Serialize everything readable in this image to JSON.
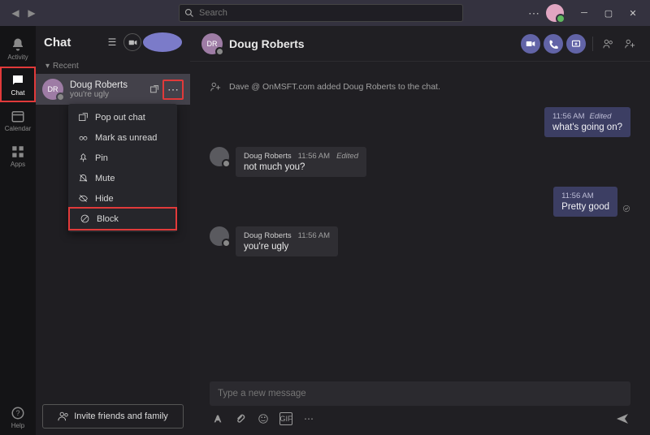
{
  "titlebar": {
    "search_placeholder": "Search"
  },
  "rail": {
    "items": [
      {
        "label": "Activity"
      },
      {
        "label": "Chat"
      },
      {
        "label": "Calendar"
      },
      {
        "label": "Apps"
      }
    ],
    "help_label": "Help"
  },
  "chatlist": {
    "title": "Chat",
    "section": "Recent",
    "items": [
      {
        "name": "Doug Roberts",
        "preview": "you're ugly",
        "initials": "DR"
      }
    ],
    "invite_label": "Invite friends and family"
  },
  "context_menu": {
    "items": [
      {
        "label": "Pop out chat"
      },
      {
        "label": "Mark as unread"
      },
      {
        "label": "Pin"
      },
      {
        "label": "Mute"
      },
      {
        "label": "Hide"
      },
      {
        "label": "Block"
      }
    ]
  },
  "conversation": {
    "title": "Doug Roberts",
    "initials": "DR",
    "system_msg": "Dave @ OnMSFT.com added Doug Roberts to the chat.",
    "messages": [
      {
        "type": "out",
        "time": "11:56 AM",
        "edited": "Edited",
        "text": "what's going on?"
      },
      {
        "type": "in",
        "name": "Doug Roberts",
        "time": "11:56 AM",
        "edited": "Edited",
        "text": "not much you?"
      },
      {
        "type": "out",
        "time": "11:56 AM",
        "text": "Pretty good",
        "read": true
      },
      {
        "type": "in",
        "name": "Doug Roberts",
        "time": "11:56 AM",
        "text": "you're ugly"
      }
    ],
    "compose_placeholder": "Type a new message"
  },
  "labels": {
    "edited": "Edited"
  }
}
